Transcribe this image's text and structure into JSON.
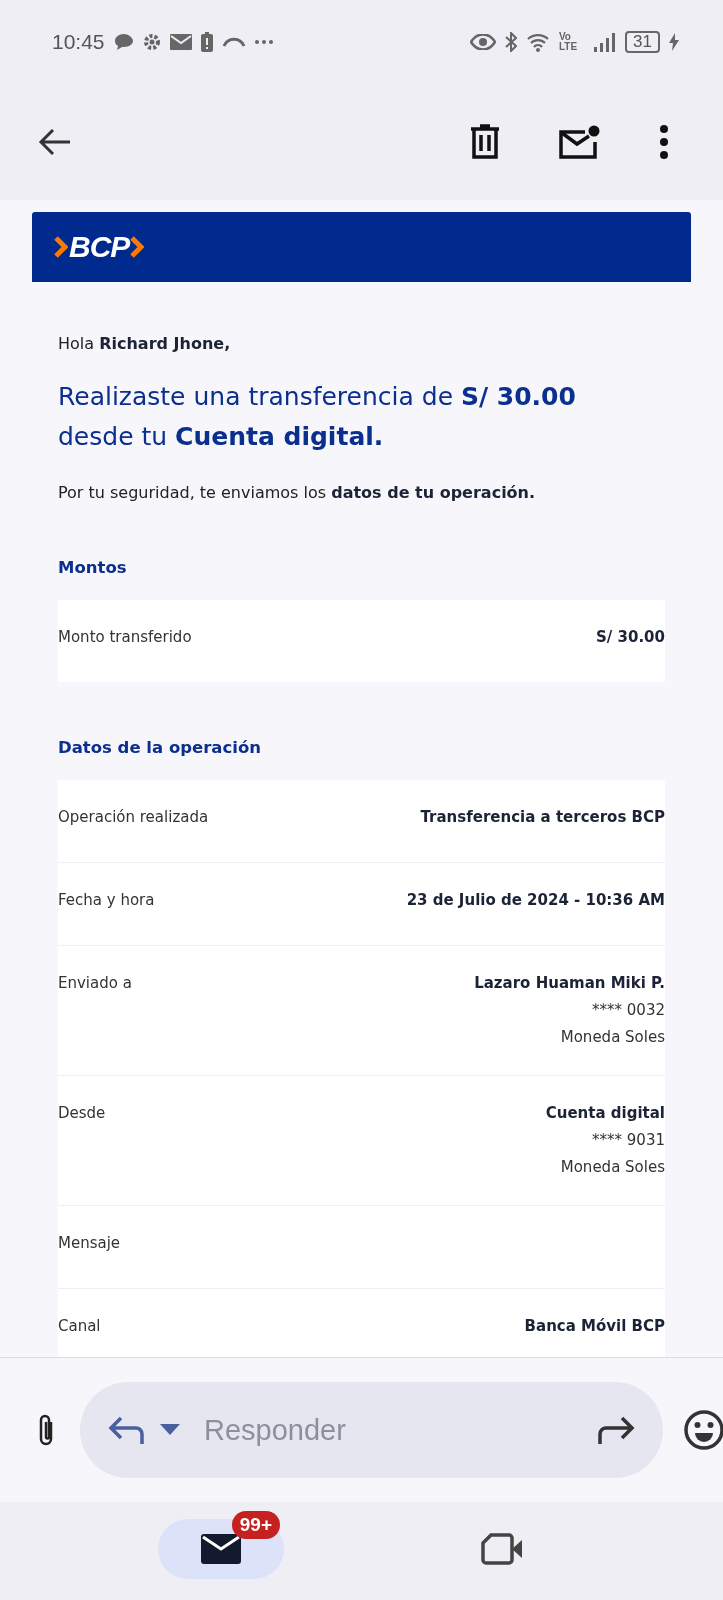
{
  "status_bar": {
    "time": "10:45",
    "volte_top": "Vo",
    "volte_bottom": "LTE",
    "battery": "31"
  },
  "email": {
    "logo": "BCP",
    "greeting": "Hola **Richard Jhone,**",
    "headline": "Realizaste una transferencia de **S/ 30.00** desde tu **Cuenta digital.**",
    "intro": "Por tu seguridad, te enviamos los **datos de tu operación.**",
    "sections": [
      {
        "title": "Montos",
        "rows": [
          {
            "label": "Monto transferido",
            "values": [
              {
                "text": "S/ 30.00",
                "bold": true
              }
            ]
          }
        ]
      },
      {
        "title": "Datos de la operación",
        "rows": [
          {
            "label": "Operación realizada",
            "values": [
              {
                "text": "Transferencia a terceros BCP",
                "bold": true
              }
            ]
          },
          {
            "label": "Fecha y hora",
            "values": [
              {
                "text": "23 de Julio de 2024 - 10:36 AM",
                "bold": true
              }
            ]
          },
          {
            "label": "Enviado a",
            "values": [
              {
                "text": "Lazaro Huaman Miki P.",
                "bold": true
              },
              {
                "text": "**** 0032",
                "bold": false
              },
              {
                "text": "Moneda Soles",
                "bold": false
              }
            ]
          },
          {
            "label": "Desde",
            "values": [
              {
                "text": "Cuenta digital",
                "bold": true
              },
              {
                "text": "**** 9031",
                "bold": false
              },
              {
                "text": "Moneda Soles",
                "bold": false
              }
            ]
          },
          {
            "label": "Mensaje",
            "values": []
          },
          {
            "label": "Canal",
            "values": [
              {
                "text": "Banca Móvil BCP",
                "bold": true
              }
            ]
          }
        ]
      }
    ]
  },
  "compose": {
    "placeholder": "Responder"
  },
  "nav": [
    {
      "kind": "mail",
      "selected": true,
      "badge": "99+"
    },
    {
      "kind": "video",
      "selected": false
    }
  ]
}
